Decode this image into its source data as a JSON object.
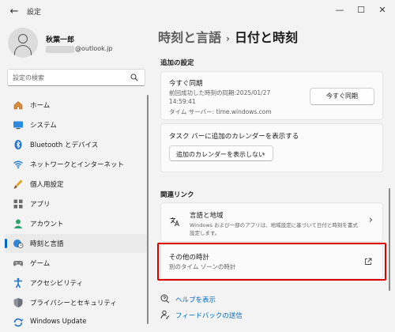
{
  "window": {
    "back_glyph": "←",
    "title": "設定",
    "minimize_glyph": "—",
    "maximize_glyph": "☐",
    "close_glyph": "✕"
  },
  "profile": {
    "name": "秋葉一郎",
    "email_suffix": "@outlook.jp"
  },
  "search": {
    "placeholder": "設定の検索"
  },
  "sidebar": {
    "items": [
      {
        "label": "ホーム",
        "icon": "home-icon",
        "active": false
      },
      {
        "label": "システム",
        "icon": "monitor-icon",
        "active": false
      },
      {
        "label": "Bluetooth とデバイス",
        "icon": "bluetooth-icon",
        "active": false
      },
      {
        "label": "ネットワークとインターネット",
        "icon": "wifi-icon",
        "active": false
      },
      {
        "label": "個人用設定",
        "icon": "brush-icon",
        "active": false
      },
      {
        "label": "アプリ",
        "icon": "apps-icon",
        "active": false
      },
      {
        "label": "アカウント",
        "icon": "account-icon",
        "active": false
      },
      {
        "label": "時刻と言語",
        "icon": "globe-clock-icon",
        "active": true
      },
      {
        "label": "ゲーム",
        "icon": "gamepad-icon",
        "active": false
      },
      {
        "label": "アクセシビリティ",
        "icon": "accessibility-icon",
        "active": false
      },
      {
        "label": "プライバシーとセキュリティ",
        "icon": "shield-icon",
        "active": false
      },
      {
        "label": "Windows Update",
        "icon": "update-icon",
        "active": false
      }
    ]
  },
  "breadcrumb": {
    "parent": "時刻と言語",
    "separator": "›",
    "current": "日付と時刻"
  },
  "additional_settings": {
    "heading": "追加の設定",
    "sync": {
      "title": "今すぐ同期",
      "last_sync": "前回成功した時刻の同期:2025/01/27",
      "last_sync_time": "14:59:41",
      "server": "タイム サーバー: time.windows.com",
      "button": "今すぐ同期"
    },
    "calendar": {
      "title": "タスク バーに追加のカレンダーを表示する",
      "selected": "追加のカレンダーを表示しない",
      "chevron": "⌄"
    }
  },
  "related_links": {
    "heading": "関連リンク",
    "region": {
      "title": "言語と地域",
      "desc_line1": "Windows および一部のアプリは、地域設定に基づいて日付と時刻を書式",
      "desc_line2": "設定します。",
      "chevron": "›"
    },
    "other_clocks": {
      "title": "その他の時計",
      "desc": "別のタイム ゾーンの時計"
    }
  },
  "footer": {
    "help": "ヘルプを表示",
    "feedback": "フィードバックの送信"
  },
  "colors": {
    "accent": "#0067c0",
    "highlight": "#e00000"
  }
}
